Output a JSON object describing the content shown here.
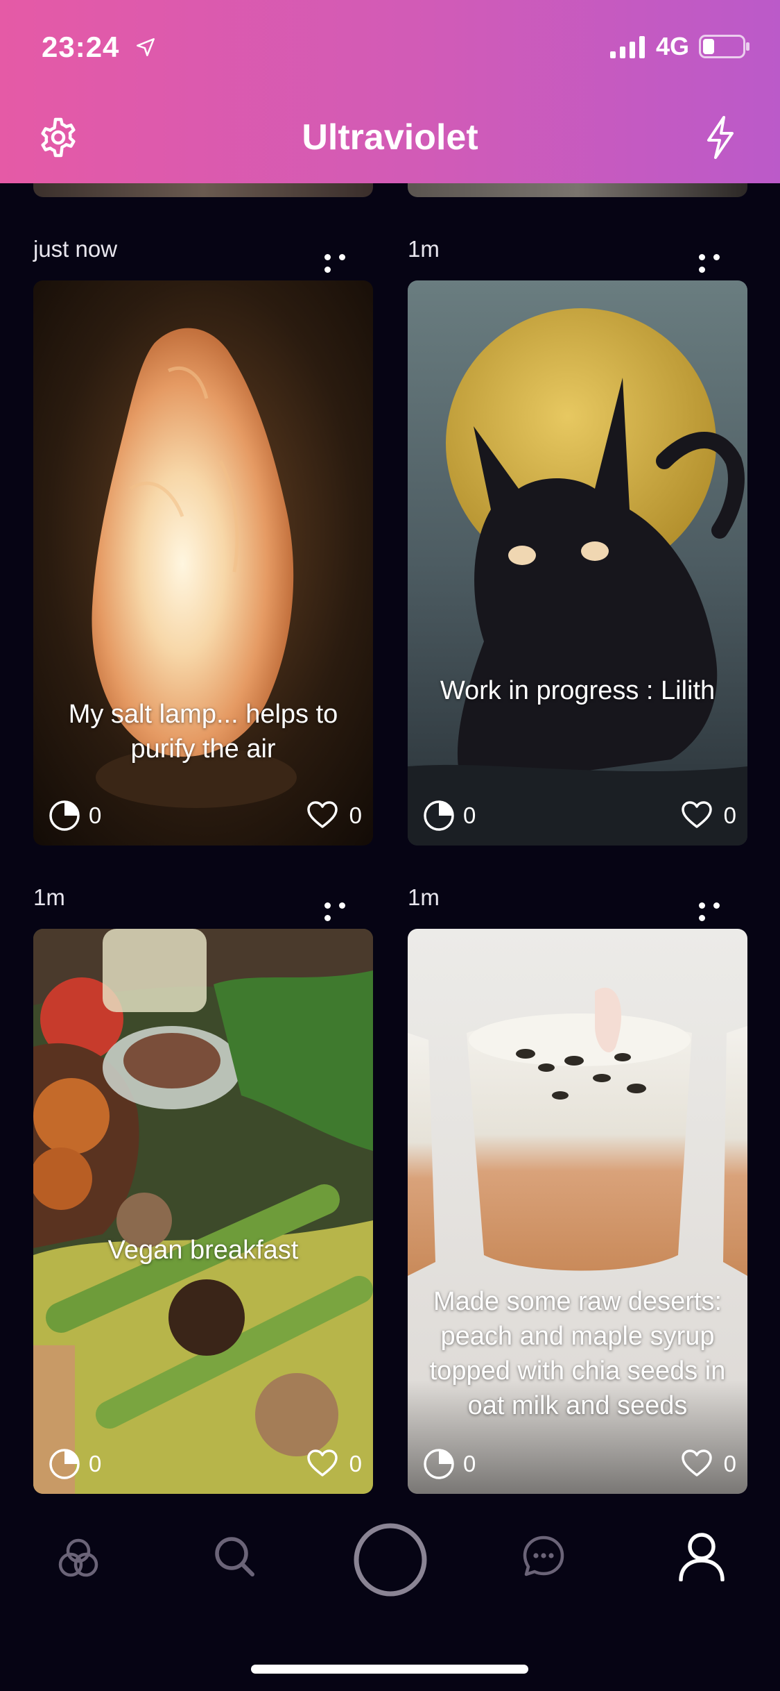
{
  "status_bar": {
    "time": "23:24",
    "network": "4G",
    "icons": [
      "location-arrow-icon",
      "signal-bars-icon",
      "battery-icon"
    ]
  },
  "header": {
    "title": "Ultraviolet",
    "left_icon": "gear-icon",
    "right_icon": "bolt-icon",
    "gradient": [
      "#e55aa6",
      "#bb5ac9"
    ]
  },
  "posts": [
    {
      "time": "just now",
      "caption": "My salt lamp... helps to purify the air",
      "views": "0",
      "likes": "0"
    },
    {
      "time": "1m",
      "caption": "Work in progress : Lilith",
      "views": "0",
      "likes": "0"
    },
    {
      "time": "1m",
      "caption": "Vegan breakfast",
      "views": "0",
      "likes": "0"
    },
    {
      "time": "1m",
      "caption": "Made some raw deserts: peach and maple syrup topped with chia seeds in oat milk and seeds",
      "views": "0",
      "likes": "0"
    }
  ],
  "bottom_nav": {
    "items": [
      "circles-icon",
      "search-icon",
      "capture-button",
      "chat-icon",
      "profile-icon"
    ],
    "active": "profile-icon"
  },
  "colors": {
    "background": "#060414",
    "accent": "#e55aa6"
  }
}
